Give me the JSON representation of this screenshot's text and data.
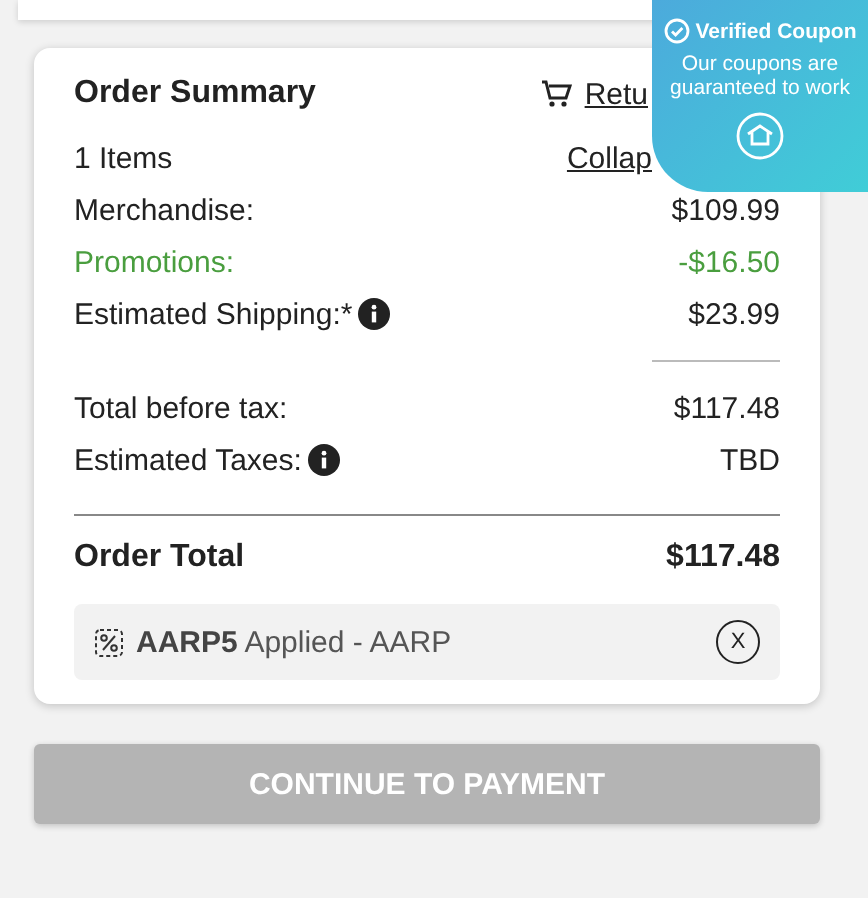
{
  "summary": {
    "title": "Order Summary",
    "return_link": "Retu",
    "items_count": "1 Items",
    "collapse_link": "Collap",
    "lines": [
      {
        "kind": "plain",
        "label": "Merchandise:",
        "value": "$109.99",
        "info_icon": false
      },
      {
        "kind": "promo",
        "label": "Promotions:",
        "value": "-$16.50",
        "info_icon": false
      },
      {
        "kind": "plain",
        "label": "Estimated Shipping:*",
        "value": "$23.99",
        "info_icon": true
      },
      {
        "kind": "divider"
      },
      {
        "kind": "plain",
        "label": "Total before tax:",
        "value": "$117.48",
        "info_icon": false
      },
      {
        "kind": "plain",
        "label": "Estimated Taxes:",
        "value": "TBD",
        "info_icon": true
      }
    ],
    "total": {
      "label": "Order Total",
      "value": "$117.48"
    },
    "coupon": {
      "code": "AARP5",
      "text": "Applied - AARP",
      "remove": "X"
    }
  },
  "continue_button": "CONTINUE TO PAYMENT",
  "verified_badge": {
    "title": "Verified Coupon",
    "text": "Our coupons are guaranteed to work"
  }
}
